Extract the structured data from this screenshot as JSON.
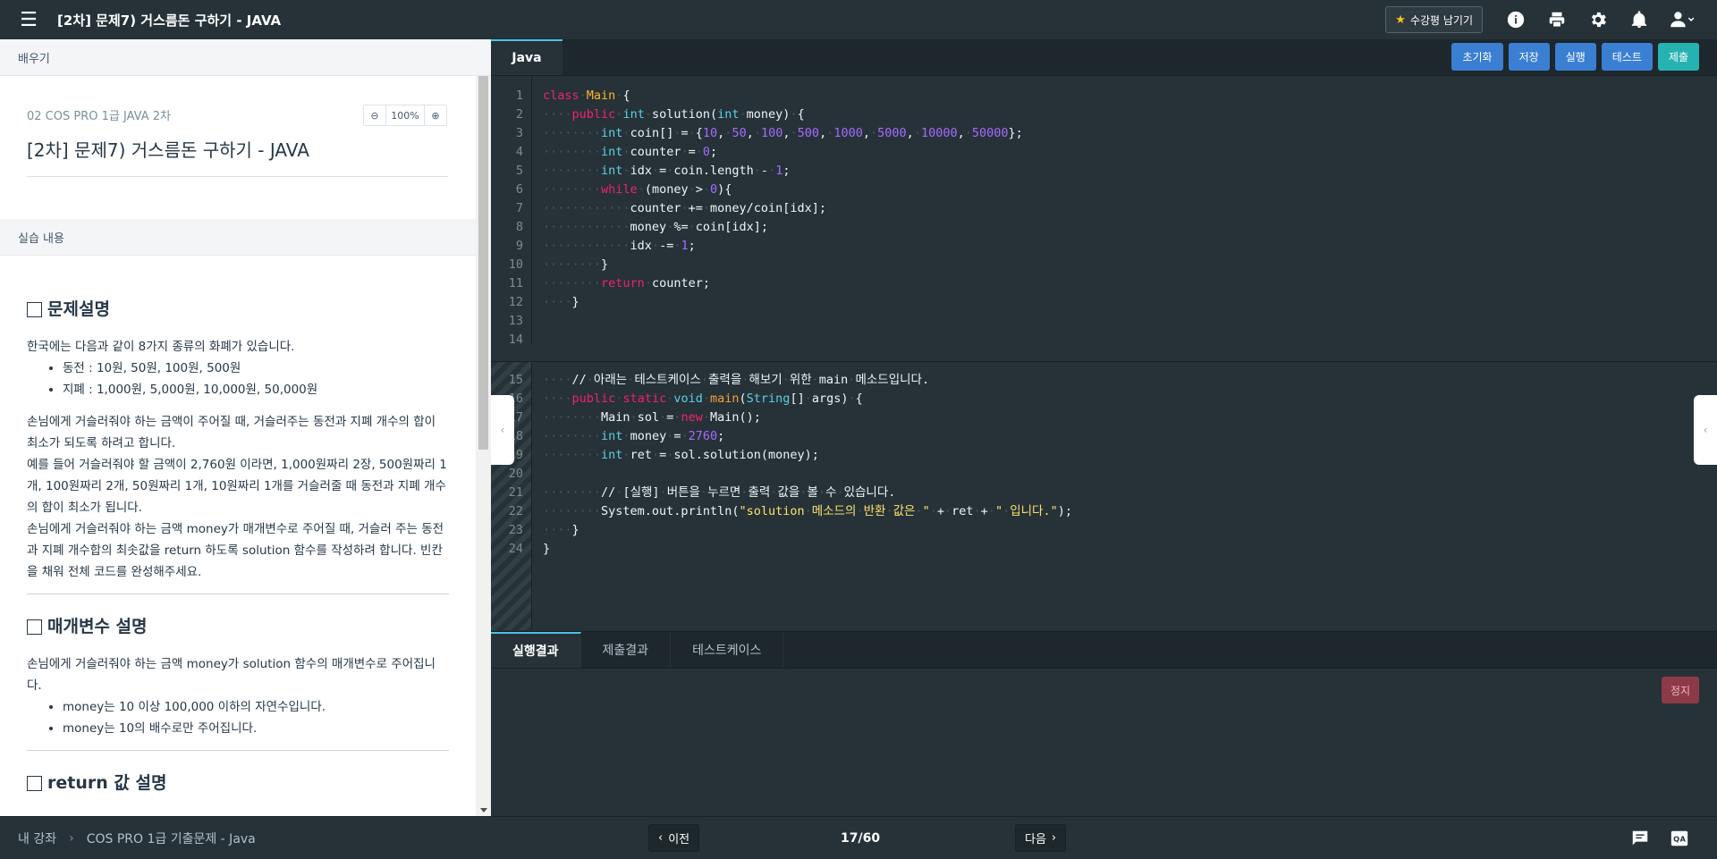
{
  "header": {
    "title": "[2차] 문제7) 거스름돈 구하기 - JAVA",
    "review_label": "수강평 남기기"
  },
  "left": {
    "section_learn": "배우기",
    "course": "02 COS PRO 1급 JAVA 2차",
    "zoom": "100%",
    "problem_title": "[2차] 문제7) 거스름돈 구하기 - JAVA",
    "section_practice": "실습 내용",
    "h_desc": "문제설명",
    "desc_intro": "한국에는 다음과 같이 8가지 종류의 화폐가 있습니다.",
    "desc_items": [
      "동전 : 10원, 50원, 100원, 500원",
      "지폐 : 1,000원, 5,000원, 10,000원, 50,000원"
    ],
    "desc_p1": "손님에게 거슬러줘야 하는 금액이 주어질 때, 거슬러주는 동전과 지폐 개수의 합이 최소가 되도록 하려고 합니다.",
    "desc_p2": "예를 들어 거슬러줘야 할 금액이 2,760원 이라면, 1,000원짜리 2장, 500원짜리 1개, 100원짜리 2개, 50원짜리 1개, 10원짜리 1개를 거슬러줄 때 동전과 지폐 개수의 합이 최소가 됩니다.",
    "desc_p3": "손님에게 거슬러줘야 하는 금액 money가 매개변수로 주어질 때, 거슬러 주는 동전과 지폐 개수합의 최솟값을 return 하도록 solution 함수를 작성하려 합니다. 빈칸을 채워 전체 코드를 완성해주세요.",
    "h_params": "매개변수 설명",
    "params_p": "손님에게 거슬러줘야 하는 금액 money가 solution 함수의 매개변수로 주어집니다.",
    "params_items": [
      "money는 10 이상 100,000 이하의 자연수입니다.",
      "money는 10의 배수로만 주어집니다."
    ],
    "h_return": "return 값 설명"
  },
  "editor": {
    "tab": "Java",
    "buttons": {
      "reset": "초기화",
      "save": "저장",
      "run": "실행",
      "test": "테스트",
      "submit": "제출"
    }
  },
  "results": {
    "tabs": [
      "실행결과",
      "제출결과",
      "테스트케이스"
    ],
    "stop": "정지"
  },
  "footer": {
    "crumb_home": "내 강좌",
    "crumb_course": "COS PRO 1급 기출문제 - Java",
    "prev": "이전",
    "page": "17/60",
    "next": "다음"
  },
  "icons": {
    "menu": "menu-icon",
    "star": "star-icon",
    "info": "info-icon",
    "print": "print-icon",
    "settings": "gear-icon",
    "bell": "bell-icon",
    "user": "user-icon",
    "zoom_out": "zoom-out-icon",
    "zoom_in": "zoom-in-icon",
    "chat": "chat-icon",
    "qa": "qa-icon"
  },
  "colors": {
    "accent": "#44c3e5",
    "primary_btn": "#3b7fd3",
    "submit_btn": "#26b2b0",
    "stop_btn": "#8c3a47",
    "bg_dark": "#263238"
  }
}
